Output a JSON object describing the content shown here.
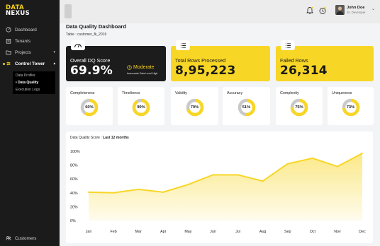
{
  "brand": {
    "line1": "DATA",
    "line2": "NEXUS",
    "accent": "#f5d11c"
  },
  "sidebar": {
    "items": [
      {
        "label": "Dashboard",
        "icon": "dashboard-icon"
      },
      {
        "label": "Tenants",
        "icon": "tenants-icon"
      },
      {
        "label": "Projects",
        "icon": "folder-icon"
      },
      {
        "label": "Control Tower",
        "icon": "control-tower-icon"
      }
    ],
    "subitems": [
      "Data Profiler",
      "Data Quality",
      "Execution Logs"
    ],
    "active_subitem": "Data Quality",
    "footer": {
      "label": "Customers",
      "icon": "customers-icon"
    }
  },
  "user": {
    "name": "John Doe",
    "role": "Sr. Developer"
  },
  "page": {
    "title": "Data Quality Dashboard",
    "table_info": "Table : customer_fk_2016"
  },
  "kpis": {
    "overall": {
      "label": "Overall DQ Score",
      "value": "69.9%",
      "status": "Moderate",
      "note": "Inaccurate Data Level High",
      "icon": "gauge-icon"
    },
    "total_rows": {
      "label": "Total Rows Processed",
      "value": "8,95,223",
      "icon": "list-icon"
    },
    "failed_rows": {
      "label": "Failed Rows",
      "value": "26,314",
      "icon": "list-icon"
    }
  },
  "metrics": [
    {
      "label": "Completeness",
      "value": "60%",
      "fraction": 0.6
    },
    {
      "label": "Timeliness",
      "value": "90%",
      "fraction": 0.9
    },
    {
      "label": "Validity",
      "value": "70%",
      "fraction": 0.7
    },
    {
      "label": "Accuracy",
      "value": "51%",
      "fraction": 0.51
    },
    {
      "label": "Complexity",
      "value": "75%",
      "fraction": 0.75
    },
    {
      "label": "Uniqueness",
      "value": "73%",
      "fraction": 0.73
    }
  ],
  "colors": {
    "accent": "#f8d626",
    "donut_track": "#c9c9c9",
    "dark": "#1c1c1c"
  },
  "chart_data": {
    "type": "area",
    "title_prefix": "Data Quality Score : ",
    "title_bold": "Last 12 months",
    "categories": [
      "Jan",
      "Feb",
      "Mar",
      "Apr",
      "May",
      "Jun",
      "Jul",
      "Aug",
      "Sep",
      "Oct",
      "Nov",
      "Dec"
    ],
    "values": [
      41,
      40,
      45,
      41,
      52,
      66,
      66,
      57,
      82,
      90,
      78,
      97
    ],
    "yticks": [
      "0%",
      "20%",
      "40%",
      "60%",
      "80%",
      "100%"
    ],
    "ylim": [
      0,
      100
    ],
    "grid": false
  }
}
